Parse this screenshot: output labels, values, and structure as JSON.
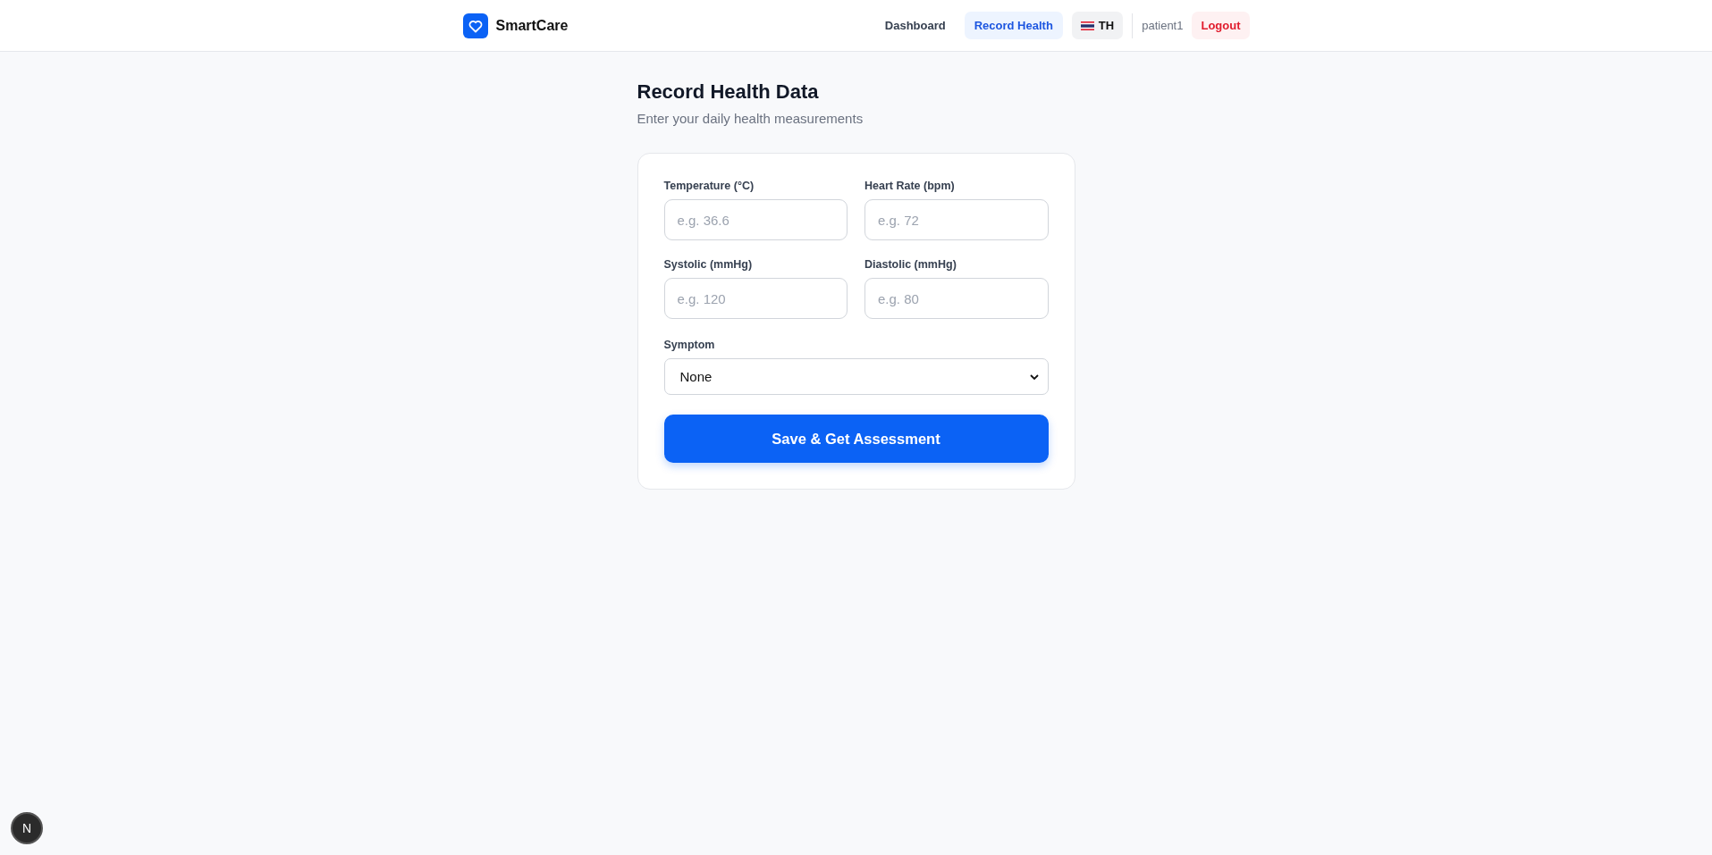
{
  "header": {
    "brand": "SmartCare",
    "nav": [
      {
        "label": "Dashboard",
        "selected": false
      },
      {
        "label": "Record Health",
        "selected": true
      }
    ],
    "language": "TH",
    "user": "patient1",
    "logout": "Logout"
  },
  "page": {
    "title": "Record Health Data",
    "subtitle": "Enter your daily health measurements"
  },
  "form": {
    "fields": [
      {
        "label": "Temperature (°C)",
        "placeholder": "e.g. 36.6"
      },
      {
        "label": "Heart Rate (bpm)",
        "placeholder": "e.g. 72"
      },
      {
        "label": "Systolic (mmHg)",
        "placeholder": "e.g. 120"
      },
      {
        "label": "Diastolic (mmHg)",
        "placeholder": "e.g. 80"
      }
    ],
    "symptom": {
      "label": "Symptom",
      "value": "None"
    },
    "submit": "Save & Get Assessment"
  },
  "dev_badge": "N"
}
